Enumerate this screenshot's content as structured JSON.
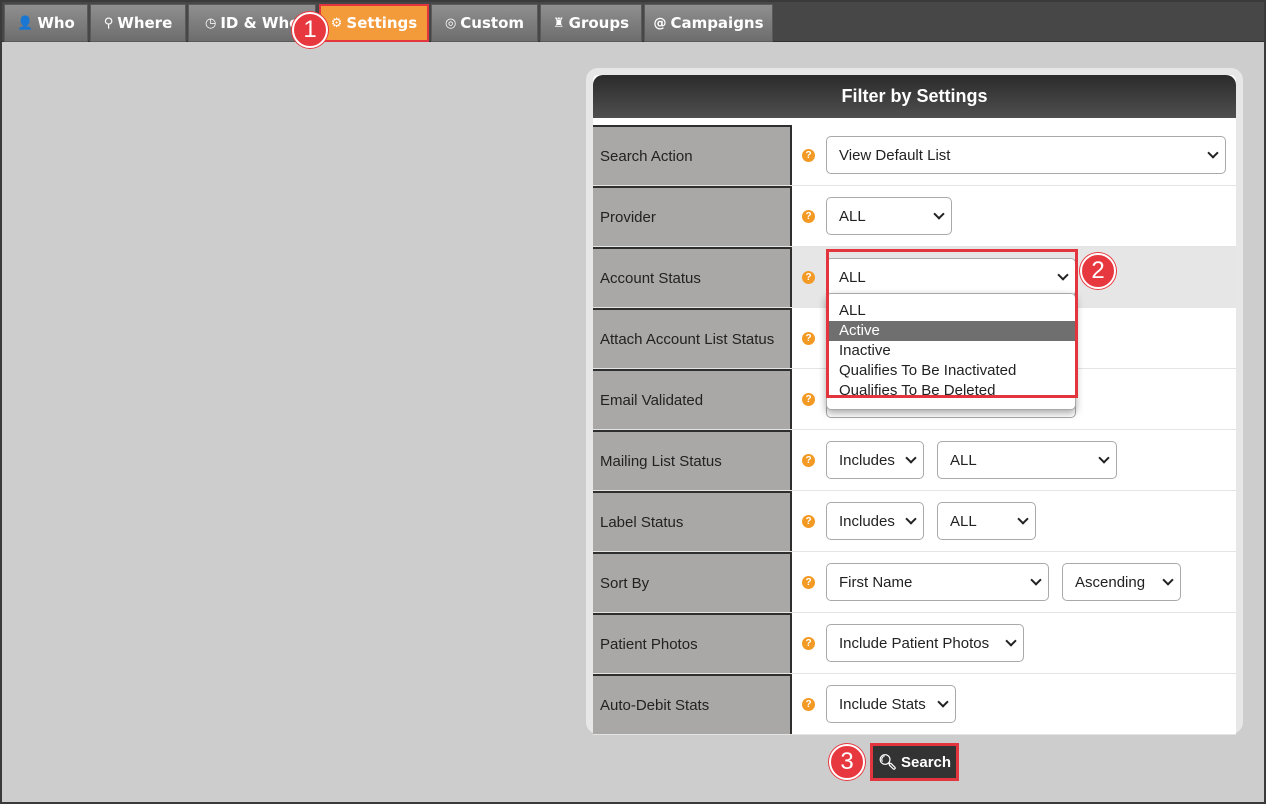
{
  "tabs": [
    {
      "label": "Who",
      "icon": "user-icon"
    },
    {
      "label": "Where",
      "icon": "map-pin-icon"
    },
    {
      "label": "ID & Whe",
      "icon": "clock-icon"
    },
    {
      "label": "Settings",
      "icon": "gear-icon",
      "active": true
    },
    {
      "label": "Custom",
      "icon": "target-icon"
    },
    {
      "label": "Groups",
      "icon": "group-icon"
    },
    {
      "label": "Campaigns",
      "icon": "at-icon"
    }
  ],
  "steps": [
    "1",
    "2",
    "3"
  ],
  "panel": {
    "title": "Filter by Settings",
    "help_glyph": "?",
    "rows": {
      "search_action": {
        "label": "Search Action",
        "value": "View Default List"
      },
      "provider": {
        "label": "Provider",
        "value": "ALL"
      },
      "account_status": {
        "label": "Account Status",
        "value": "ALL"
      },
      "attach_account_list_status": {
        "label": "Attach Account List Status"
      },
      "email_validated": {
        "label": "Email Validated"
      },
      "mailing_list_status": {
        "label": "Mailing List Status",
        "mode": "Includes",
        "value": "ALL"
      },
      "label_status": {
        "label": "Label Status",
        "mode": "Includes",
        "value": "ALL"
      },
      "sort_by": {
        "label": "Sort By",
        "value": "First Name",
        "order": "Ascending"
      },
      "patient_photos": {
        "label": "Patient Photos",
        "value": "Include Patient Photos"
      },
      "auto_debit_stats": {
        "label": "Auto-Debit Stats",
        "value": "Include Stats"
      }
    }
  },
  "account_status_options": [
    "ALL",
    "Active",
    "Inactive",
    "Qualifies To Be Inactivated",
    "Qualifies To Be Deleted"
  ],
  "account_status_hovered": "Active",
  "search_button": {
    "label": "Search"
  },
  "colors": {
    "accent": "#f39a3a",
    "highlight": "#e2353d",
    "header": "#474747"
  }
}
